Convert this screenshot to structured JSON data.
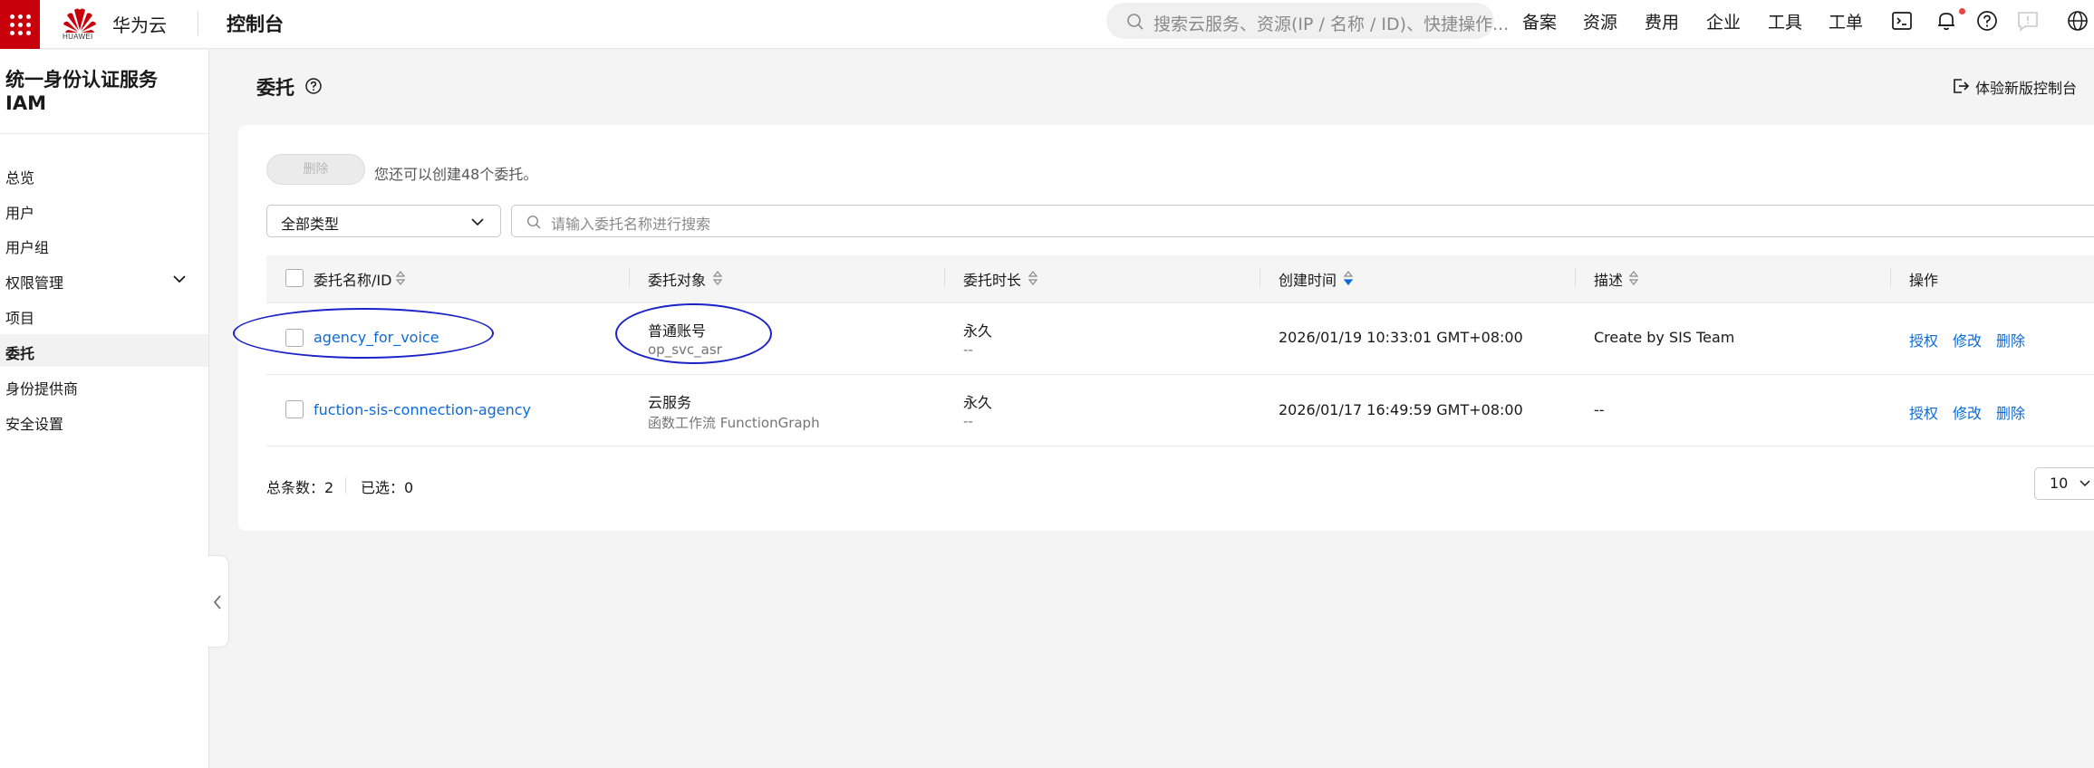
{
  "topbar": {
    "logo_text": "HUAWEI",
    "brand": "华为云",
    "console": "控制台",
    "search_placeholder": "搜索云服务、资源(IP / 名称 / ID)、快捷操作...",
    "nav": [
      "备案",
      "资源",
      "费用",
      "企业",
      "工具",
      "工单"
    ],
    "accent": "#c7000b"
  },
  "sidebar": {
    "title": "统一身份认证服务 IAM",
    "items": [
      {
        "label": "总览"
      },
      {
        "label": "用户"
      },
      {
        "label": "用户组"
      },
      {
        "label": "权限管理"
      },
      {
        "label": "项目"
      },
      {
        "label": "委托"
      },
      {
        "label": "身份提供商"
      },
      {
        "label": "安全设置"
      }
    ]
  },
  "page": {
    "title": "委托",
    "new_console": "体验新版控制台"
  },
  "toolbar": {
    "delete_label": "删除",
    "quota_text": "您还可以创建48个委托。",
    "type_select": "全部类型",
    "search_placeholder": "请输入委托名称进行搜索"
  },
  "table": {
    "headers": [
      "委托名称/ID",
      "委托对象",
      "委托时长",
      "创建时间",
      "描述",
      "操作"
    ],
    "rows": [
      {
        "name": "agency_for_voice",
        "object": "普通账号",
        "object_sub": "op_svc_asr",
        "duration": "永久",
        "duration_sub": "--",
        "created": "2026/01/19 10:33:01 GMT+08:00",
        "description": "Create by SIS Team",
        "actions": [
          "授权",
          "修改",
          "删除"
        ]
      },
      {
        "name": "fuction-sis-connection-agency",
        "object": "云服务",
        "object_sub": "函数工作流 FunctionGraph",
        "duration": "永久",
        "duration_sub": "--",
        "created": "2026/01/17 16:49:59 GMT+08:00",
        "description": "--",
        "actions": [
          "授权",
          "修改",
          "删除"
        ]
      }
    ]
  },
  "footer": {
    "total": "总条数：2",
    "selected": "已选：0",
    "page_size": "10"
  },
  "icons": [
    "menu-grid-icon",
    "huawei-logo-icon",
    "search-icon",
    "terminal-icon",
    "bell-icon",
    "help-icon",
    "feedback-icon",
    "globe-icon",
    "chevron-down-icon",
    "chevron-left-icon",
    "exit-icon",
    "sort-icon"
  ]
}
